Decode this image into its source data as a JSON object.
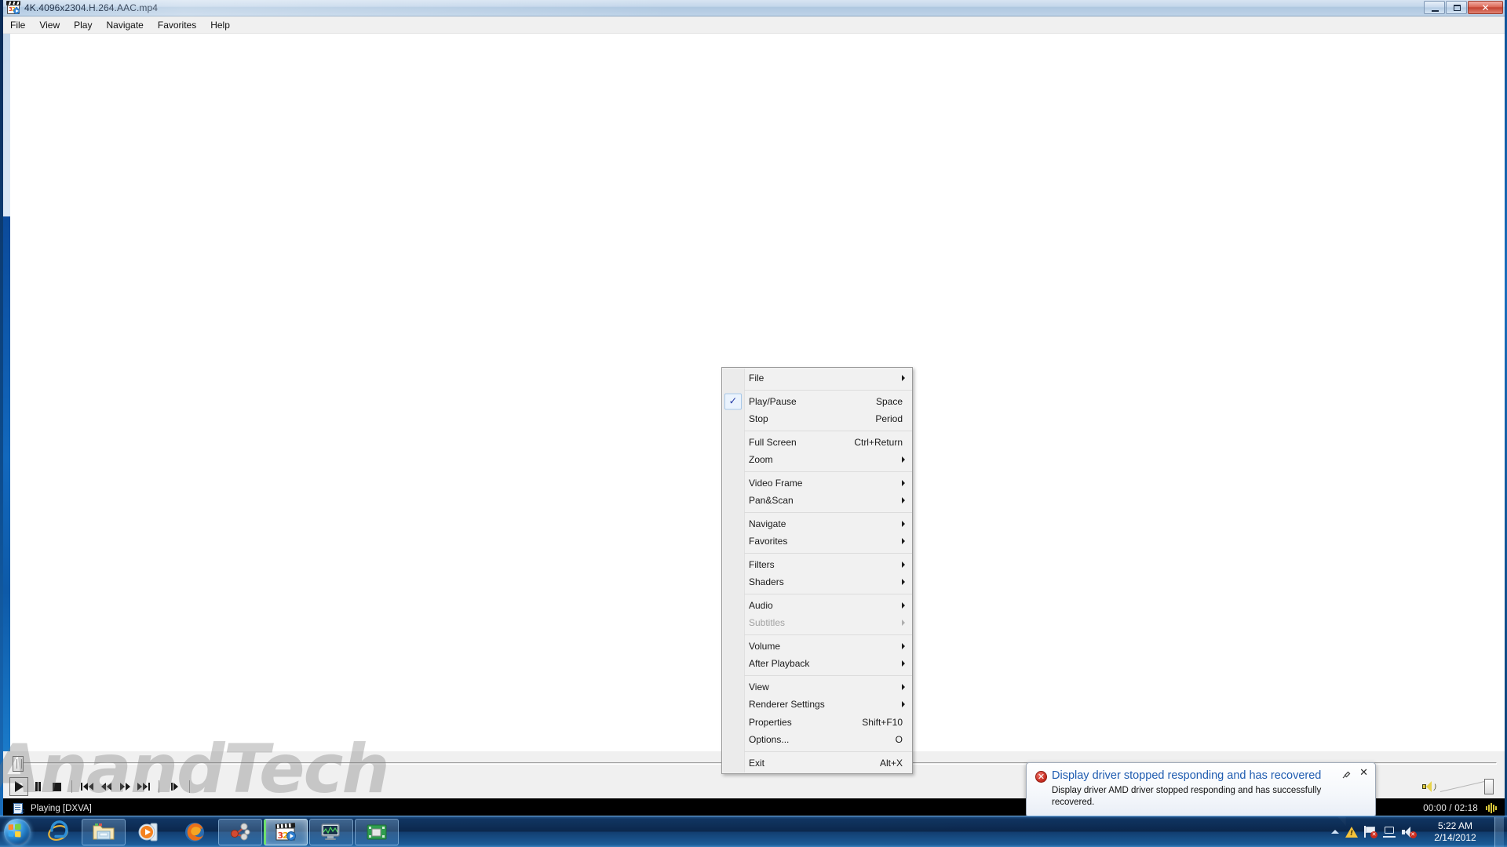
{
  "window": {
    "title": "4K.4096x2304.H.264.AAC.mp4",
    "app_icon": "mpc-hc-clapperboard-icon",
    "buttons": {
      "minimize": "minimize-button",
      "maximize": "maximize-button",
      "close": "close-button",
      "close_glyph": "✕"
    }
  },
  "menubar": {
    "items": [
      {
        "label": "File"
      },
      {
        "label": "View"
      },
      {
        "label": "Play"
      },
      {
        "label": "Navigate"
      },
      {
        "label": "Favorites"
      },
      {
        "label": "Help"
      }
    ]
  },
  "watermark": {
    "text": "AnandTech"
  },
  "transport": {
    "buttons": [
      {
        "name": "play-button",
        "icon": "play",
        "pressed": true
      },
      {
        "name": "pause-button",
        "icon": "pause",
        "pressed": false
      },
      {
        "name": "stop-button",
        "icon": "stop",
        "pressed": false
      },
      {
        "name": "skip-back-button",
        "icon": "skip-back",
        "pressed": false
      },
      {
        "name": "rewind-button",
        "icon": "rewind",
        "pressed": false
      },
      {
        "name": "fast-forward-button",
        "icon": "fast-forward",
        "pressed": false
      },
      {
        "name": "skip-forward-button",
        "icon": "skip-forward",
        "pressed": false
      },
      {
        "name": "frame-step-button",
        "icon": "frame-step",
        "pressed": false
      }
    ],
    "volume": {
      "icon": "speaker-icon",
      "level_percent": 100
    }
  },
  "statusbar": {
    "icon": "media-file-icon",
    "text": "Playing [DXVA]",
    "time": "00:00 / 02:18",
    "audio_indicator": "audio-level-meter"
  },
  "context_menu": {
    "items": [
      {
        "label": "File",
        "accel": "",
        "submenu": true,
        "checked": false,
        "disabled": false
      },
      {
        "separator": true
      },
      {
        "label": "Play/Pause",
        "accel": "Space",
        "submenu": false,
        "checked": true,
        "disabled": false
      },
      {
        "label": "Stop",
        "accel": "Period",
        "submenu": false,
        "checked": false,
        "disabled": false
      },
      {
        "separator": true
      },
      {
        "label": "Full Screen",
        "accel": "Ctrl+Return",
        "submenu": false,
        "checked": false,
        "disabled": false
      },
      {
        "label": "Zoom",
        "accel": "",
        "submenu": true,
        "checked": false,
        "disabled": false
      },
      {
        "separator": true
      },
      {
        "label": "Video Frame",
        "accel": "",
        "submenu": true,
        "checked": false,
        "disabled": false
      },
      {
        "label": "Pan&Scan",
        "accel": "",
        "submenu": true,
        "checked": false,
        "disabled": false
      },
      {
        "separator": true
      },
      {
        "label": "Navigate",
        "accel": "",
        "submenu": true,
        "checked": false,
        "disabled": false
      },
      {
        "label": "Favorites",
        "accel": "",
        "submenu": true,
        "checked": false,
        "disabled": false
      },
      {
        "separator": true
      },
      {
        "label": "Filters",
        "accel": "",
        "submenu": true,
        "checked": false,
        "disabled": false
      },
      {
        "label": "Shaders",
        "accel": "",
        "submenu": true,
        "checked": false,
        "disabled": false
      },
      {
        "separator": true
      },
      {
        "label": "Audio",
        "accel": "",
        "submenu": true,
        "checked": false,
        "disabled": false
      },
      {
        "label": "Subtitles",
        "accel": "",
        "submenu": true,
        "checked": false,
        "disabled": true
      },
      {
        "separator": true
      },
      {
        "label": "Volume",
        "accel": "",
        "submenu": true,
        "checked": false,
        "disabled": false
      },
      {
        "label": "After Playback",
        "accel": "",
        "submenu": true,
        "checked": false,
        "disabled": false
      },
      {
        "separator": true
      },
      {
        "label": "View",
        "accel": "",
        "submenu": true,
        "checked": false,
        "disabled": false
      },
      {
        "label": "Renderer Settings",
        "accel": "",
        "submenu": true,
        "checked": false,
        "disabled": false
      },
      {
        "label": "Properties",
        "accel": "Shift+F10",
        "submenu": false,
        "checked": false,
        "disabled": false
      },
      {
        "label": "Options...",
        "accel": "O",
        "submenu": false,
        "checked": false,
        "disabled": false
      },
      {
        "separator": true
      },
      {
        "label": "Exit",
        "accel": "Alt+X",
        "submenu": false,
        "checked": false,
        "disabled": false
      }
    ],
    "check_glyph": "✓"
  },
  "notification": {
    "icon": "error-icon",
    "icon_glyph": "✕",
    "title": "Display driver stopped responding and has recovered",
    "body": "Display driver AMD driver stopped responding and has successfully recovered.",
    "pin_icon": "pin-icon",
    "close_glyph": "✕",
    "title_color": "#1f5cb0"
  },
  "taskbar": {
    "start": {
      "name": "start-orb",
      "label": "Start"
    },
    "buttons": [
      {
        "name": "taskbar-internet-explorer",
        "icon": "internet-explorer-icon",
        "framed": false,
        "active": false
      },
      {
        "name": "taskbar-windows-explorer",
        "icon": "folder-icon",
        "framed": true,
        "active": false
      },
      {
        "name": "taskbar-windows-media-player",
        "icon": "media-player-icon",
        "framed": false,
        "active": false
      },
      {
        "name": "taskbar-firefox",
        "icon": "firefox-icon",
        "framed": false,
        "active": false
      },
      {
        "name": "taskbar-molecule-app",
        "icon": "molecule-icon",
        "framed": true,
        "active": false
      },
      {
        "name": "taskbar-mpc-hc",
        "icon": "mpc-hc-clapperboard-icon",
        "framed": true,
        "active": true
      },
      {
        "name": "taskbar-monitor-app",
        "icon": "monitor-graph-icon",
        "framed": true,
        "active": false
      },
      {
        "name": "taskbar-gpuz-app",
        "icon": "chip-icon",
        "framed": true,
        "active": false
      }
    ],
    "tray": {
      "chevron": "show-hidden-icons-chevron",
      "icons": [
        {
          "name": "warning-icon"
        },
        {
          "name": "action-center-flag-icon"
        },
        {
          "name": "network-icon"
        },
        {
          "name": "volume-muted-icon"
        }
      ]
    },
    "clock": {
      "time": "5:22 AM",
      "date": "2/14/2012"
    },
    "show_desktop": "show-desktop-button"
  }
}
